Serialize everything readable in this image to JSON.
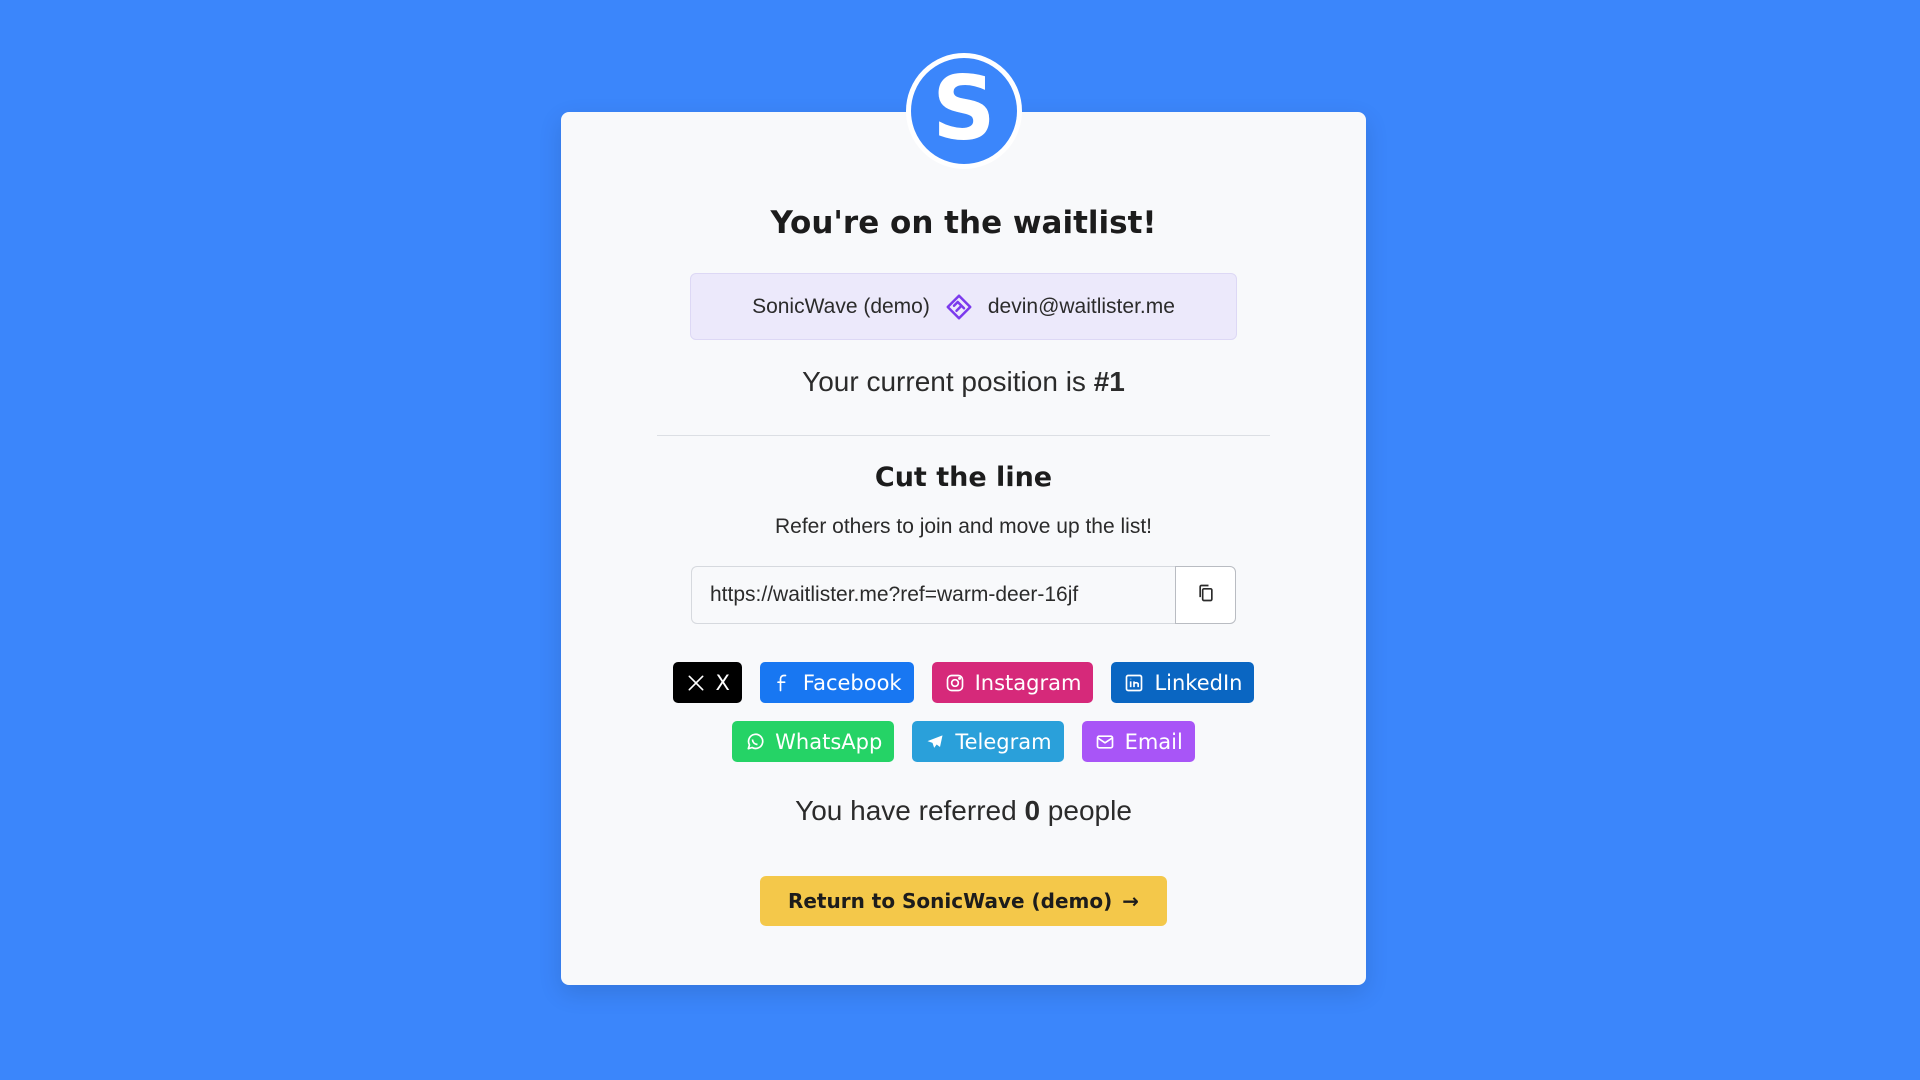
{
  "colors": {
    "background": "#3b86fb",
    "card": "#f8f9fb",
    "info_box": "#ece9fb",
    "accent_purple": "#7c3aed",
    "return_button": "#f4c84a"
  },
  "logo": {
    "letter": "S"
  },
  "heading": "You're on the waitlist!",
  "info": {
    "product": "SonicWave (demo)",
    "email": "devin@waitlister.me",
    "separator_icon": "heart-handshake-icon"
  },
  "position": {
    "prefix": "Your current position is ",
    "value": "#1"
  },
  "cut": {
    "title": "Cut the line",
    "subtitle": "Refer others to join and move up the list!"
  },
  "referral": {
    "link": "https://waitlister.me?ref=warm-deer-16jf",
    "copy_icon": "copy-icon"
  },
  "share": [
    {
      "label": "X",
      "icon": "x-logo-icon",
      "color": "#000000"
    },
    {
      "label": "Facebook",
      "icon": "facebook-icon",
      "color": "#1877f2"
    },
    {
      "label": "Instagram",
      "icon": "instagram-icon",
      "color": "#d6297a"
    },
    {
      "label": "LinkedIn",
      "icon": "linkedin-icon",
      "color": "#0a66c2"
    },
    {
      "label": "WhatsApp",
      "icon": "whatsapp-icon",
      "color": "#25d366"
    },
    {
      "label": "Telegram",
      "icon": "telegram-icon",
      "color": "#2aa0da"
    },
    {
      "label": "Email",
      "icon": "mail-icon",
      "color": "#a855f7"
    }
  ],
  "referred": {
    "prefix": "You have referred ",
    "count": "0",
    "suffix": " people"
  },
  "return_button": {
    "label": "Return to SonicWave (demo)",
    "arrow": "→"
  }
}
